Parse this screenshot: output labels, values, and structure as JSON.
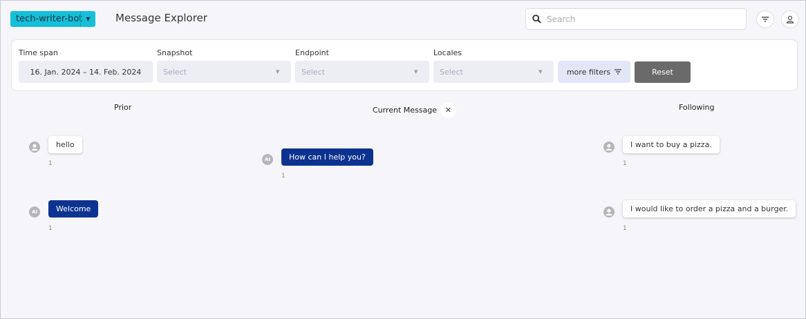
{
  "header": {
    "bot_name": "tech-writer-bot",
    "title": "Message Explorer",
    "search_placeholder": "Search"
  },
  "filters": {
    "time_span": {
      "label": "Time span",
      "value": "16. Jan. 2024 – 14. Feb. 2024"
    },
    "snapshot": {
      "label": "Snapshot",
      "placeholder": "Select"
    },
    "endpoint": {
      "label": "Endpoint",
      "placeholder": "Select"
    },
    "locales": {
      "label": "Locales",
      "placeholder": "Select"
    },
    "more_filters": "more filters",
    "reset": "Reset"
  },
  "columns": {
    "prior": "Prior",
    "current": "Current Message",
    "following": "Following"
  },
  "messages": {
    "prior": [
      {
        "text": "hello",
        "sender": "user",
        "count": "1"
      },
      {
        "text": "Welcome",
        "sender": "bot",
        "count": "1"
      }
    ],
    "current": {
      "text": "How can I help you?",
      "sender": "bot",
      "count": "1"
    },
    "following": [
      {
        "text": "I want to buy a pizza.",
        "sender": "user",
        "count": "1"
      },
      {
        "text": "I would like to order a pizza and a burger.",
        "sender": "user",
        "count": "1"
      }
    ]
  },
  "icons": {
    "bot_avatar": "AI",
    "close": "✕",
    "caret": "▼"
  },
  "colors": {
    "accent": "#15c0d6",
    "bot_bubble": "#0d3390",
    "reset_button": "#6a6a6a",
    "background": "#f6f6fa"
  }
}
